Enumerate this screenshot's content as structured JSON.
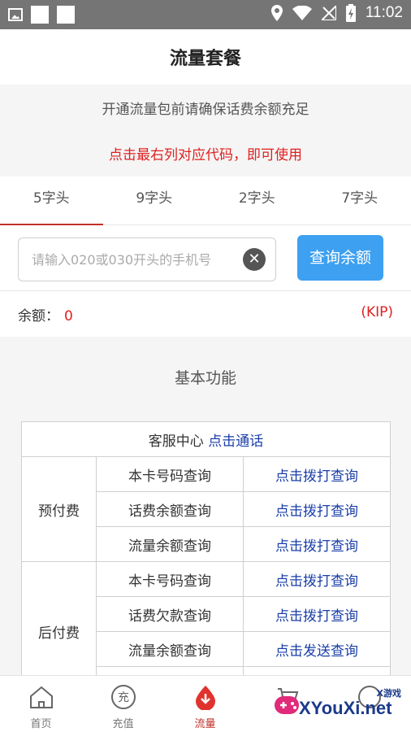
{
  "status_bar": {
    "time": "11:02",
    "icons": [
      "image-icon",
      "square-icon",
      "square-icon",
      "location-icon",
      "wifi-icon",
      "no-signal-icon",
      "battery-charging-icon"
    ]
  },
  "header": {
    "title": "流量套餐"
  },
  "notice": {
    "line1": "开通流量包前请确保话费余额充足",
    "line2": "点击最右列对应代码，即可使用"
  },
  "tabs": [
    {
      "label": "5字头",
      "active": true
    },
    {
      "label": "9字头",
      "active": false
    },
    {
      "label": "2字头",
      "active": false
    },
    {
      "label": "7字头",
      "active": false
    }
  ],
  "search": {
    "placeholder": "请输入020或030开头的手机号",
    "value": "",
    "button_label": "查询余额"
  },
  "balance": {
    "label": "余额：",
    "value": "0",
    "unit": "(KIP)"
  },
  "basic": {
    "title": "基本功能",
    "service_center": {
      "label": "客服中心",
      "link": "点击通话"
    },
    "groups": [
      {
        "name": "预付费",
        "rows": [
          {
            "item": "本卡号码查询",
            "action": "点击拨打查询"
          },
          {
            "item": "话费余额查询",
            "action": "点击拨打查询"
          },
          {
            "item": "流量余额查询",
            "action": "点击拨打查询"
          }
        ]
      },
      {
        "name": "后付费",
        "rows": [
          {
            "item": "本卡号码查询",
            "action": "点击拨打查询"
          },
          {
            "item": "话费欠款查询",
            "action": "点击拨打查询"
          },
          {
            "item": "流量余额查询",
            "action": "点击发送查询"
          }
        ]
      }
    ]
  },
  "bottom_nav": [
    {
      "label": "首页",
      "icon": "home-icon",
      "active": false
    },
    {
      "label": "充值",
      "icon": "recharge-icon",
      "active": false
    },
    {
      "label": "流量",
      "icon": "traffic-icon",
      "active": true
    }
  ],
  "watermark": {
    "text": "XYouXi.net",
    "top": "X游戏"
  },
  "colors": {
    "accent_red": "#e02020",
    "tab_underline": "#c0302a",
    "button_blue": "#3da0f0",
    "link_blue": "#1a3ea8"
  }
}
